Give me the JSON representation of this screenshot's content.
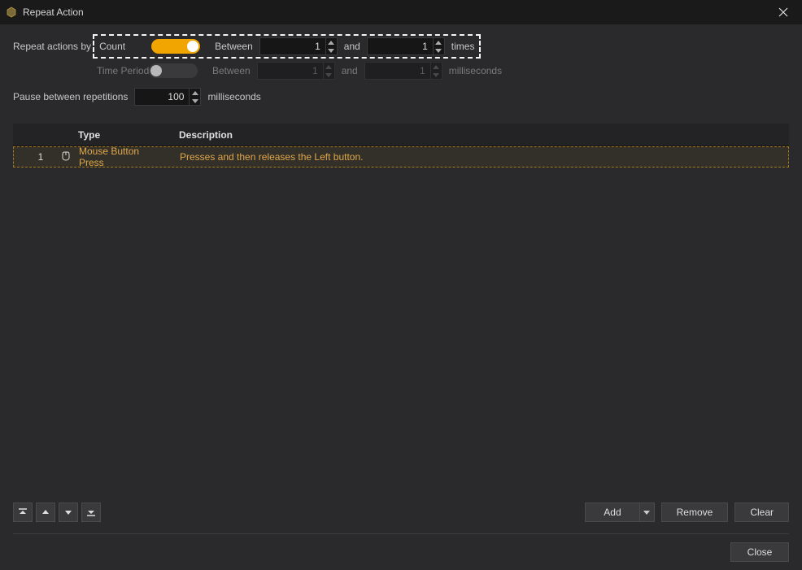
{
  "window": {
    "title": "Repeat Action"
  },
  "form": {
    "repeat_by_label": "Repeat actions by",
    "count": {
      "label": "Count",
      "toggle_on": true,
      "between_label": "Between",
      "from": "1",
      "and_label": "and",
      "to": "1",
      "unit": "times"
    },
    "time": {
      "label": "Time Period",
      "toggle_on": false,
      "between_label": "Between",
      "from": "1",
      "and_label": "and",
      "to": "1",
      "unit": "milliseconds"
    },
    "pause": {
      "label": "Pause between repetitions",
      "value": "100",
      "unit": "milliseconds"
    }
  },
  "table": {
    "headers": {
      "type": "Type",
      "description": "Description"
    },
    "rows": [
      {
        "index": "1",
        "type": "Mouse Button Press",
        "description": "Presses and then releases the Left button."
      }
    ]
  },
  "buttons": {
    "add": "Add",
    "remove": "Remove",
    "clear": "Clear",
    "close": "Close"
  }
}
